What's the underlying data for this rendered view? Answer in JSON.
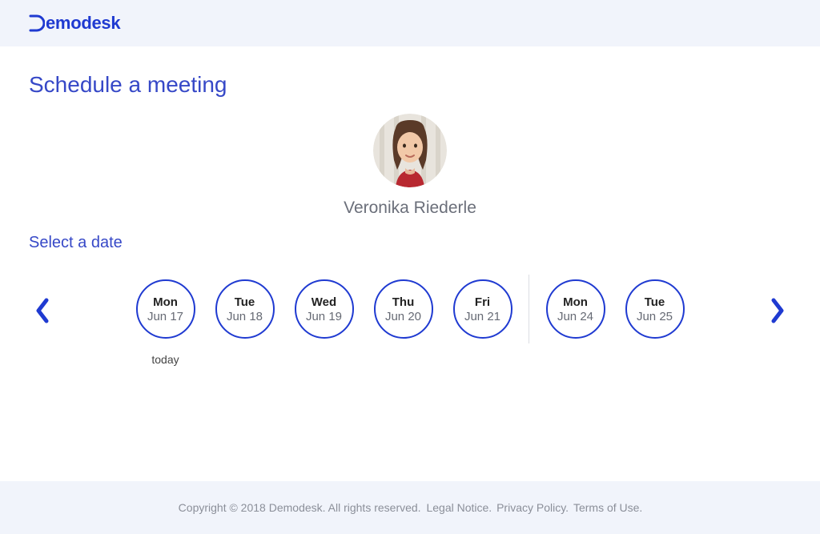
{
  "header": {
    "logo_text": "emodesk"
  },
  "main": {
    "page_title": "Schedule a meeting",
    "host_name": "Veronika Riederle",
    "select_date_label": "Select a date"
  },
  "dates": [
    {
      "day": "Mon",
      "date": "Jun 17",
      "today_label": "today"
    },
    {
      "day": "Tue",
      "date": "Jun 18"
    },
    {
      "day": "Wed",
      "date": "Jun 19"
    },
    {
      "day": "Thu",
      "date": "Jun 20"
    },
    {
      "day": "Fri",
      "date": "Jun 21"
    },
    {
      "day": "Mon",
      "date": "Jun 24"
    },
    {
      "day": "Tue",
      "date": "Jun 25"
    }
  ],
  "footer": {
    "copyright": "Copyright © 2018 Demodesk. All rights reserved.",
    "legal_notice": "Legal Notice.",
    "privacy_policy": "Privacy Policy.",
    "terms_of_use": "Terms of Use."
  }
}
